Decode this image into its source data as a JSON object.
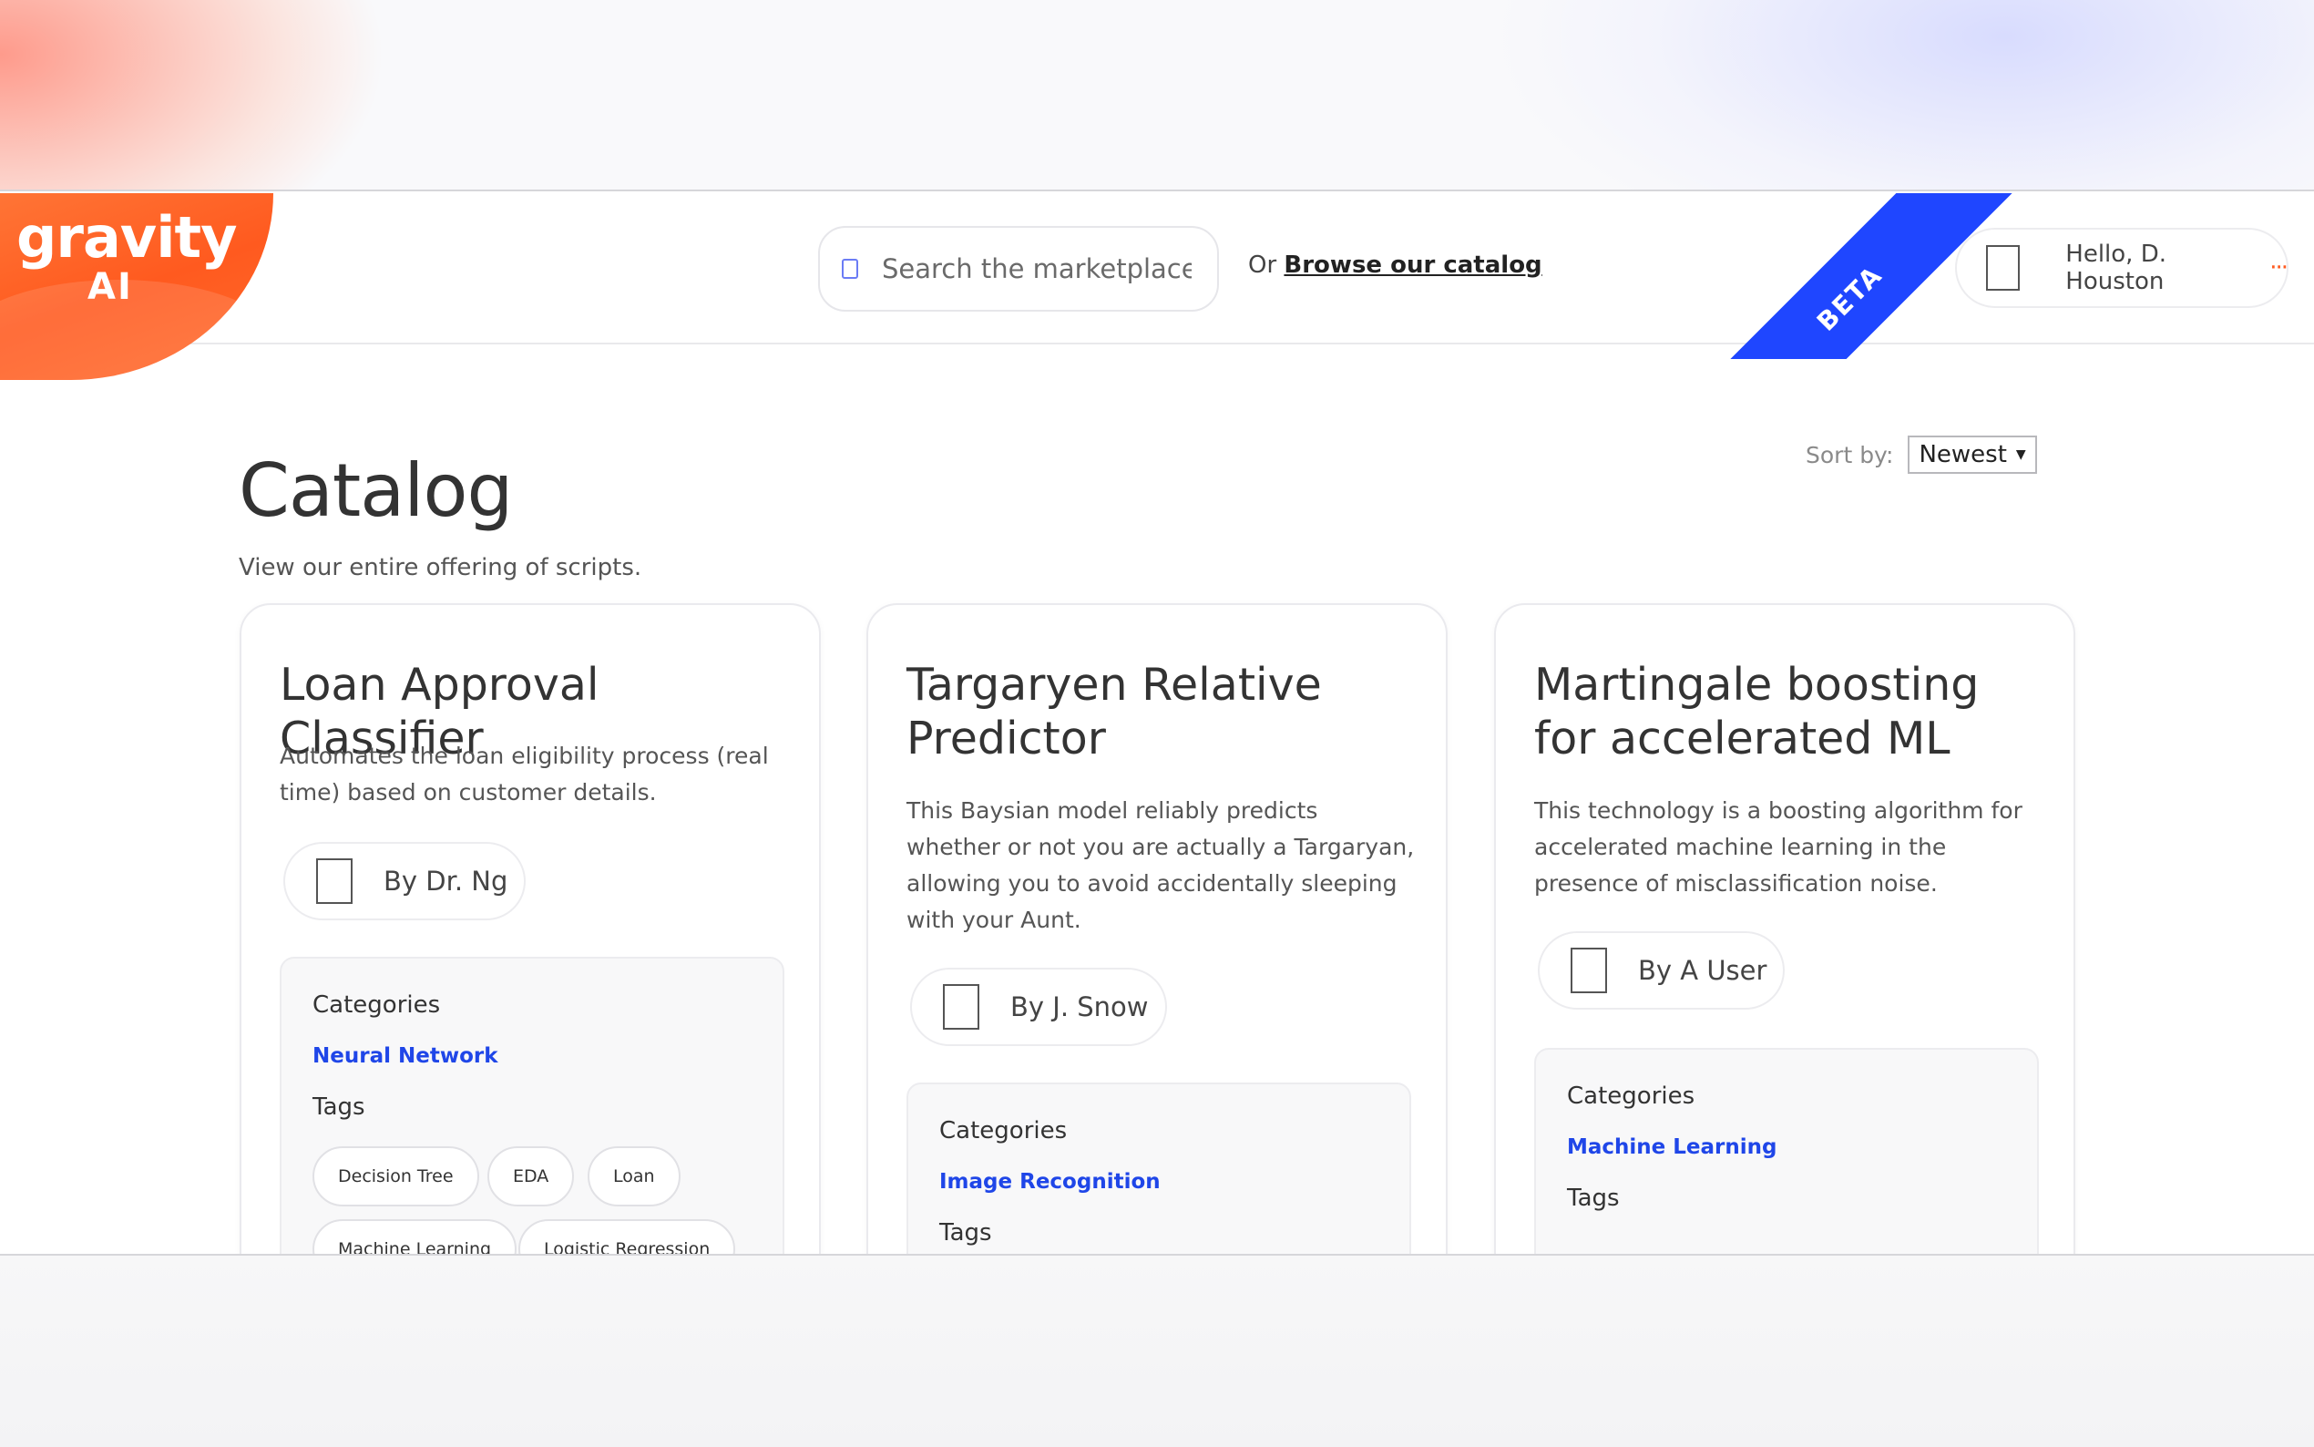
{
  "brand": {
    "logo_text": "gravity",
    "logo_sub": "AI",
    "beta_label": "BETA"
  },
  "header": {
    "search_placeholder": "Search the marketplace",
    "browse_prefix": "Or",
    "browse_link": "Browse our catalog",
    "user_greeting": "Hello, D. Houston",
    "more": "···"
  },
  "page": {
    "title": "Catalog",
    "subtitle": "View our entire offering of scripts.",
    "sort_label": "Sort by:",
    "sort_value": "Newest"
  },
  "cards": [
    {
      "title": "Loan Approval Classifier",
      "description": "Automates the loan eligibility process (real time) based on customer details.",
      "author": "By Dr. Ng",
      "categories_label": "Categories",
      "category": "Neural Network",
      "tags_label": "Tags",
      "tags": [
        "Decision Tree",
        "EDA",
        "Loan",
        "Machine Learning",
        "Logistic Regression"
      ]
    },
    {
      "title": "Targaryen Relative Predictor",
      "description": "This Baysian model reliably predicts whether or not you are actually a Targaryan, allowing you to avoid accidentally sleeping with your Aunt.",
      "author": "By J. Snow",
      "categories_label": "Categories",
      "category": "Image Recognition",
      "tags_label": "Tags",
      "tags": []
    },
    {
      "title": "Martingale boosting for accelerated ML",
      "description": "This technology is a boosting algorithm for accelerated machine learning in the presence of misclassification noise.",
      "author": "By A User",
      "categories_label": "Categories",
      "category": "Machine Learning",
      "tags_label": "Tags",
      "tags": []
    }
  ],
  "colors": {
    "brand_orange": "#ff5a1f",
    "beta_blue": "#1f46ff",
    "link_blue": "#1f46e8"
  }
}
